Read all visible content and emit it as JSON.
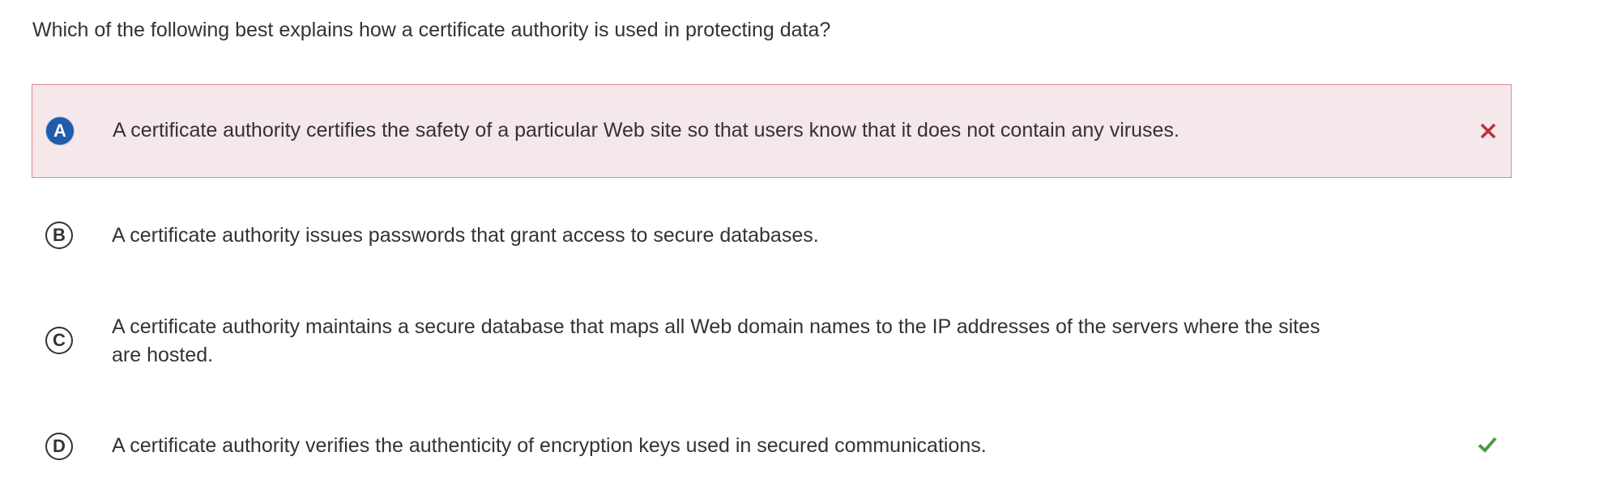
{
  "question": {
    "text": "Which of the following best explains how a certificate authority is used in protecting data?"
  },
  "choices": [
    {
      "letter": "A",
      "text": "A certificate authority certifies the safety of a particular Web site so that users know that it does not contain any viruses.",
      "selected": true,
      "status": "incorrect",
      "status_icon": "x-icon"
    },
    {
      "letter": "B",
      "text": "A certificate authority issues passwords that grant access to secure databases.",
      "selected": false,
      "status": "none"
    },
    {
      "letter": "C",
      "text": "A certificate authority maintains a secure database that maps all Web domain names to the IP addresses of the servers where the sites are hosted.",
      "selected": false,
      "status": "none"
    },
    {
      "letter": "D",
      "text": "A certificate authority verifies the authenticity of encryption keys used in secured communications.",
      "selected": false,
      "status": "correct",
      "status_icon": "check-icon"
    }
  ],
  "colors": {
    "text": "#333333",
    "selected_letter_bg": "#1f5cab",
    "wrong_bg": "#f5e8ea",
    "wrong_border": "#e08890",
    "wrong_mark": "#b8343f",
    "correct_mark": "#4a9d3f"
  }
}
